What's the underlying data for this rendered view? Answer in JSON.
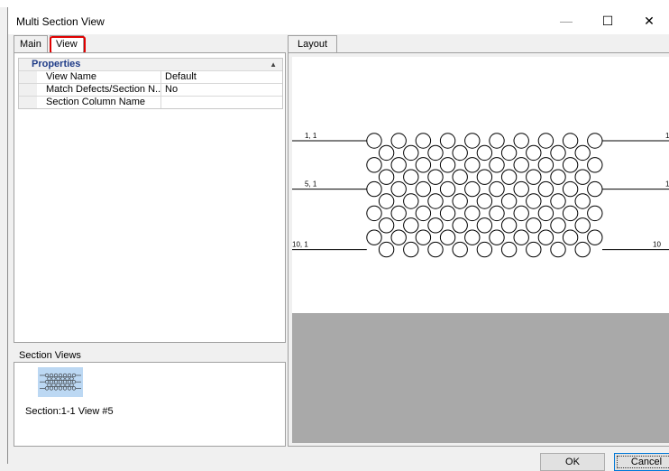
{
  "window": {
    "title": "Multi Section View",
    "controls": {
      "minimize": "—",
      "maximize": "☐",
      "close": "✕"
    }
  },
  "left_tabs": [
    {
      "label": "Main",
      "active": false
    },
    {
      "label": "View",
      "active": true
    }
  ],
  "properties": {
    "category": "Properties",
    "rows": [
      {
        "name": "View Name",
        "value": "Default"
      },
      {
        "name": "Match Defects/Section N...",
        "value": "No"
      },
      {
        "name": "Section Column Name",
        "value": ""
      }
    ]
  },
  "section_views": {
    "heading": "Section Views",
    "items": [
      {
        "label": "Section:1-1 View #5",
        "selected": true
      }
    ]
  },
  "right_tabs": [
    {
      "label": "Layout",
      "active": true
    }
  ],
  "layout": {
    "row_labels_left": [
      "1, 1",
      "5, 1",
      "10, 1"
    ],
    "row_labels_right": [
      "1",
      "1",
      "10"
    ],
    "grid": {
      "rows": 10,
      "even_row_columns": 10,
      "odd_row_columns": 9
    }
  },
  "buttons": {
    "ok": "OK",
    "cancel": "Cancel"
  },
  "colors": {
    "highlight": "#e00000",
    "accent": "#0078d7",
    "category_text": "#1f3c88",
    "thumbnail": "#bcd8f3"
  }
}
